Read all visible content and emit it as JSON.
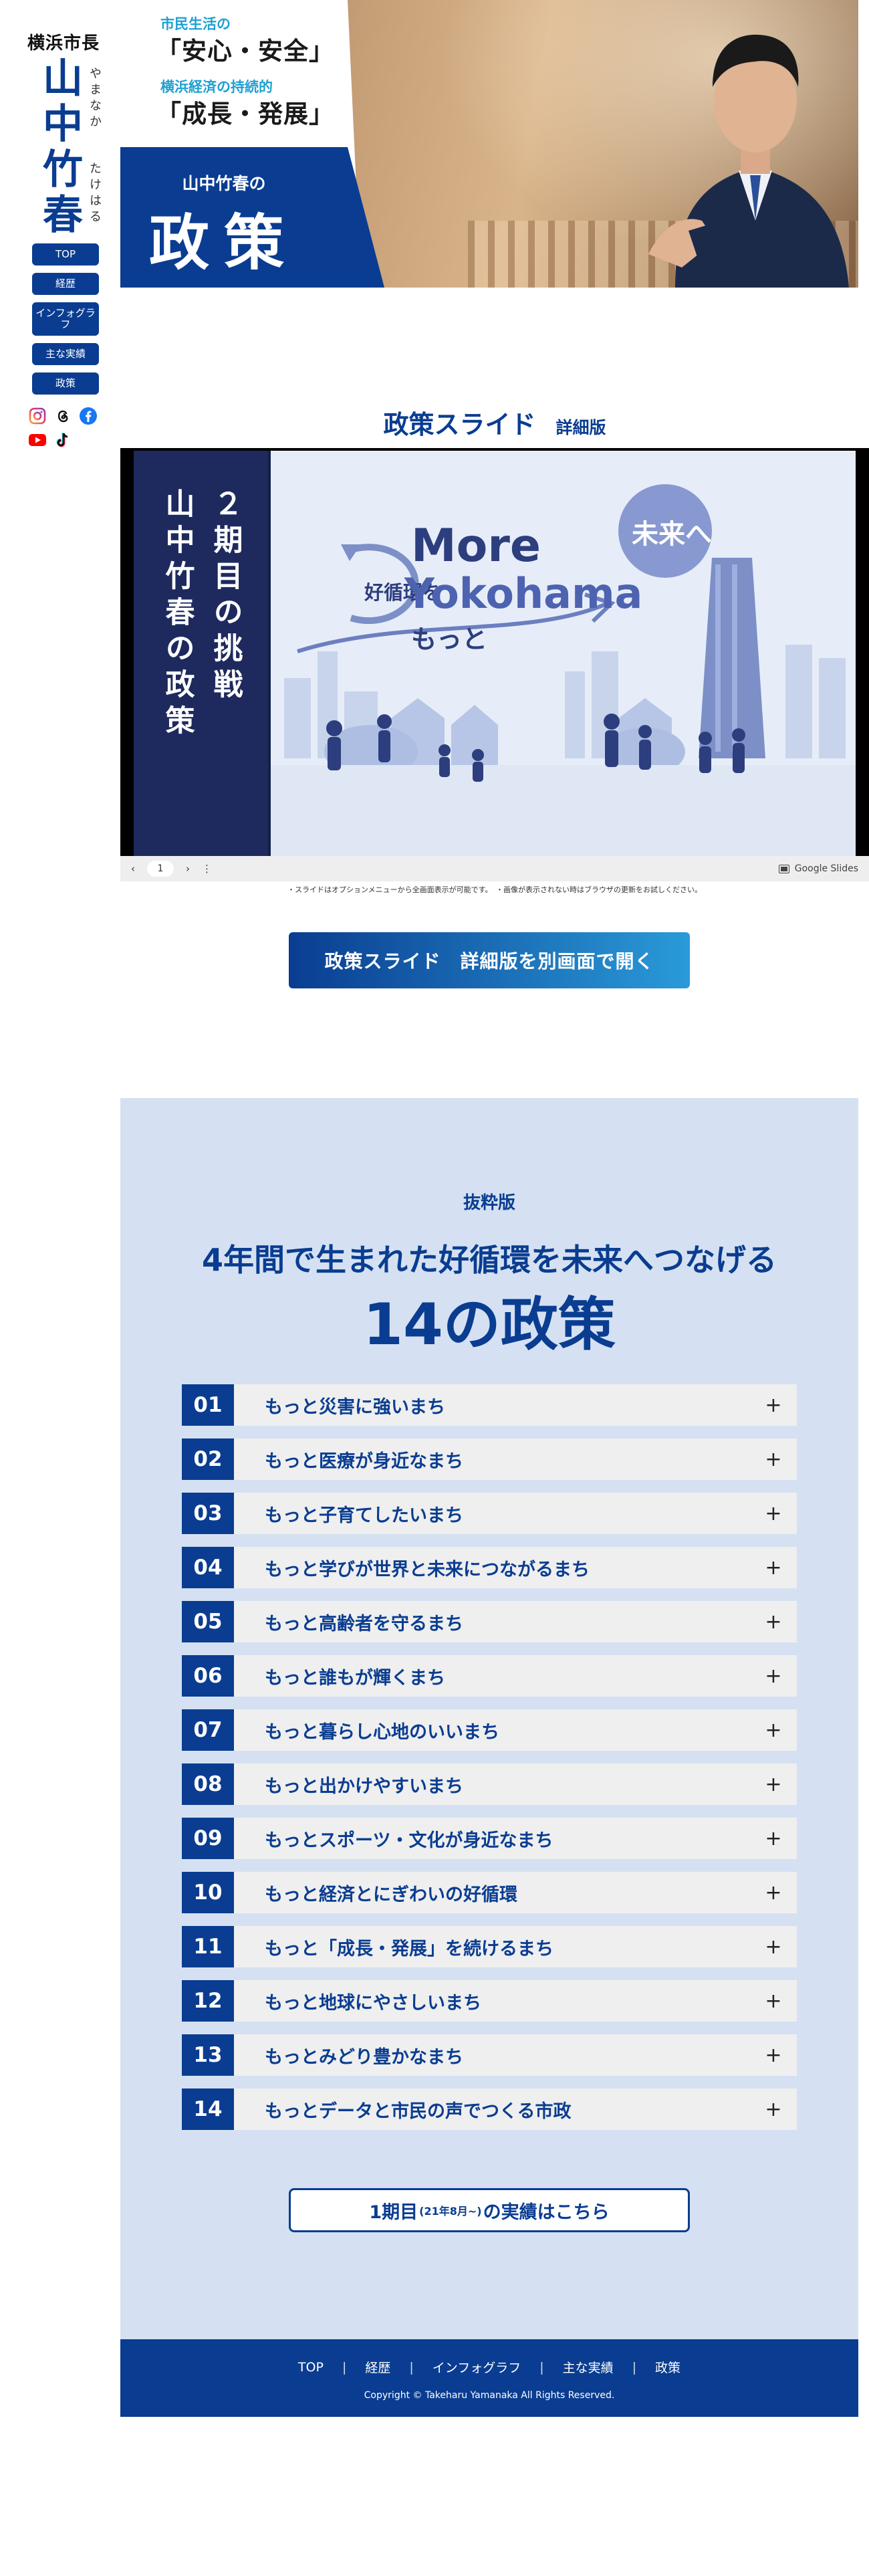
{
  "sidebar": {
    "title": "横浜市長",
    "name_chars": [
      "山",
      "中",
      "竹",
      "春"
    ],
    "kana_given": "やまなか",
    "kana_family": "たけはる",
    "nav": [
      "TOP",
      "経歴",
      "インフォグラフ",
      "主な実績",
      "政策"
    ]
  },
  "social": [
    "instagram-icon",
    "threads-icon",
    "facebook-icon",
    "youtube-icon",
    "tiktok-icon"
  ],
  "hero": {
    "sub1": "市民生活の",
    "main1": "「安心・安全」",
    "sub2": "横浜経済の持続的",
    "main2": "「成長・発展」",
    "blue_small": "山中竹春の",
    "blue_big": "政策"
  },
  "slides": {
    "title": "政策スライド",
    "subtitle": "詳細版",
    "left_col1": "２期目の挑戦",
    "left_col2": "山中竹春の政策",
    "more": "More",
    "yokohama": "Yokohama",
    "future": "未来へ",
    "cycle": "好循環を",
    "motto": "もっと",
    "page": "1",
    "google_slides": "Google Slides",
    "note": "・スライドはオプションメニューから全画面表示が可能です。　・画像が表示されない時はブラウザの更新をお試しください。",
    "open_button": "政策スライド　詳細版を別画面で開く"
  },
  "policy": {
    "label": "抜粋版",
    "heading1": "4年間で生まれた好循環を未来へつなげる",
    "heading2": "14の政策",
    "items": [
      {
        "num": "01",
        "text": "もっと災害に強いまち"
      },
      {
        "num": "02",
        "text": "もっと医療が身近なまち"
      },
      {
        "num": "03",
        "text": "もっと子育てしたいまち"
      },
      {
        "num": "04",
        "text": "もっと学びが世界と未来につながるまち"
      },
      {
        "num": "05",
        "text": "もっと高齢者を守るまち"
      },
      {
        "num": "06",
        "text": "もっと誰もが輝くまち"
      },
      {
        "num": "07",
        "text": "もっと暮らし心地のいいまち"
      },
      {
        "num": "08",
        "text": "もっと出かけやすいまち"
      },
      {
        "num": "09",
        "text": "もっとスポーツ・文化が身近なまち"
      },
      {
        "num": "10",
        "text": "もっと経済とにぎわいの好循環"
      },
      {
        "num": "11",
        "text": "もっと「成長・発展」を続けるまち"
      },
      {
        "num": "12",
        "text": "もっと地球にやさしいまち"
      },
      {
        "num": "13",
        "text": "もっとみどり豊かなまち"
      },
      {
        "num": "14",
        "text": "もっとデータと市民の声でつくる市政"
      }
    ],
    "expand_symbol": "+",
    "achievements_main": "1期目",
    "achievements_small": "(21年8月~)",
    "achievements_tail": "の実績はこちら"
  },
  "footer": {
    "nav": [
      "TOP",
      "経歴",
      "インフォグラフ",
      "主な実績",
      "政策"
    ],
    "separator": "|",
    "copyright": "Copyright © Takeharu Yamanaka All Rights Reserved."
  },
  "colors": {
    "brand_blue": "#0a3d91",
    "accent_cyan": "#1ea0d2",
    "policy_bg": "#d5e1f2"
  }
}
